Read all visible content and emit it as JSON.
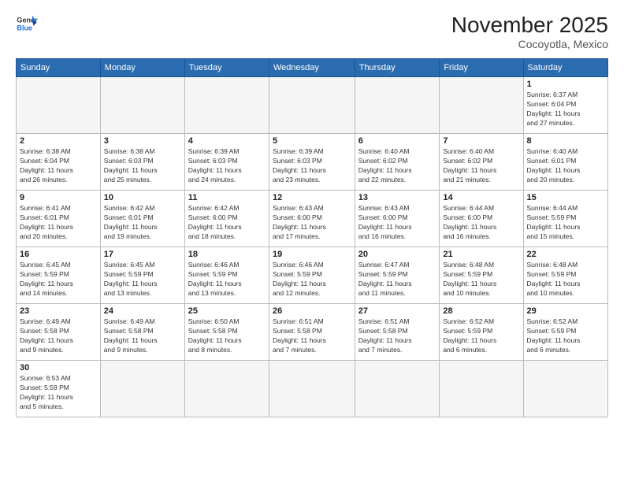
{
  "header": {
    "logo_line1": "General",
    "logo_line2": "Blue",
    "month_title": "November 2025",
    "location": "Cocoyotla, Mexico"
  },
  "weekdays": [
    "Sunday",
    "Monday",
    "Tuesday",
    "Wednesday",
    "Thursday",
    "Friday",
    "Saturday"
  ],
  "weeks": [
    [
      {
        "day": "",
        "info": ""
      },
      {
        "day": "",
        "info": ""
      },
      {
        "day": "",
        "info": ""
      },
      {
        "day": "",
        "info": ""
      },
      {
        "day": "",
        "info": ""
      },
      {
        "day": "",
        "info": ""
      },
      {
        "day": "1",
        "info": "Sunrise: 6:37 AM\nSunset: 6:04 PM\nDaylight: 11 hours\nand 27 minutes."
      }
    ],
    [
      {
        "day": "2",
        "info": "Sunrise: 6:38 AM\nSunset: 6:04 PM\nDaylight: 11 hours\nand 26 minutes."
      },
      {
        "day": "3",
        "info": "Sunrise: 6:38 AM\nSunset: 6:03 PM\nDaylight: 11 hours\nand 25 minutes."
      },
      {
        "day": "4",
        "info": "Sunrise: 6:39 AM\nSunset: 6:03 PM\nDaylight: 11 hours\nand 24 minutes."
      },
      {
        "day": "5",
        "info": "Sunrise: 6:39 AM\nSunset: 6:03 PM\nDaylight: 11 hours\nand 23 minutes."
      },
      {
        "day": "6",
        "info": "Sunrise: 6:40 AM\nSunset: 6:02 PM\nDaylight: 11 hours\nand 22 minutes."
      },
      {
        "day": "7",
        "info": "Sunrise: 6:40 AM\nSunset: 6:02 PM\nDaylight: 11 hours\nand 21 minutes."
      },
      {
        "day": "8",
        "info": "Sunrise: 6:40 AM\nSunset: 6:01 PM\nDaylight: 11 hours\nand 20 minutes."
      }
    ],
    [
      {
        "day": "9",
        "info": "Sunrise: 6:41 AM\nSunset: 6:01 PM\nDaylight: 11 hours\nand 20 minutes."
      },
      {
        "day": "10",
        "info": "Sunrise: 6:42 AM\nSunset: 6:01 PM\nDaylight: 11 hours\nand 19 minutes."
      },
      {
        "day": "11",
        "info": "Sunrise: 6:42 AM\nSunset: 6:00 PM\nDaylight: 11 hours\nand 18 minutes."
      },
      {
        "day": "12",
        "info": "Sunrise: 6:43 AM\nSunset: 6:00 PM\nDaylight: 11 hours\nand 17 minutes."
      },
      {
        "day": "13",
        "info": "Sunrise: 6:43 AM\nSunset: 6:00 PM\nDaylight: 11 hours\nand 16 minutes."
      },
      {
        "day": "14",
        "info": "Sunrise: 6:44 AM\nSunset: 6:00 PM\nDaylight: 11 hours\nand 16 minutes."
      },
      {
        "day": "15",
        "info": "Sunrise: 6:44 AM\nSunset: 5:59 PM\nDaylight: 11 hours\nand 15 minutes."
      }
    ],
    [
      {
        "day": "16",
        "info": "Sunrise: 6:45 AM\nSunset: 5:59 PM\nDaylight: 11 hours\nand 14 minutes."
      },
      {
        "day": "17",
        "info": "Sunrise: 6:45 AM\nSunset: 5:59 PM\nDaylight: 11 hours\nand 13 minutes."
      },
      {
        "day": "18",
        "info": "Sunrise: 6:46 AM\nSunset: 5:59 PM\nDaylight: 11 hours\nand 13 minutes."
      },
      {
        "day": "19",
        "info": "Sunrise: 6:46 AM\nSunset: 5:59 PM\nDaylight: 11 hours\nand 12 minutes."
      },
      {
        "day": "20",
        "info": "Sunrise: 6:47 AM\nSunset: 5:59 PM\nDaylight: 11 hours\nand 11 minutes."
      },
      {
        "day": "21",
        "info": "Sunrise: 6:48 AM\nSunset: 5:59 PM\nDaylight: 11 hours\nand 10 minutes."
      },
      {
        "day": "22",
        "info": "Sunrise: 6:48 AM\nSunset: 5:59 PM\nDaylight: 11 hours\nand 10 minutes."
      }
    ],
    [
      {
        "day": "23",
        "info": "Sunrise: 6:49 AM\nSunset: 5:58 PM\nDaylight: 11 hours\nand 9 minutes."
      },
      {
        "day": "24",
        "info": "Sunrise: 6:49 AM\nSunset: 5:58 PM\nDaylight: 11 hours\nand 9 minutes."
      },
      {
        "day": "25",
        "info": "Sunrise: 6:50 AM\nSunset: 5:58 PM\nDaylight: 11 hours\nand 8 minutes."
      },
      {
        "day": "26",
        "info": "Sunrise: 6:51 AM\nSunset: 5:58 PM\nDaylight: 11 hours\nand 7 minutes."
      },
      {
        "day": "27",
        "info": "Sunrise: 6:51 AM\nSunset: 5:58 PM\nDaylight: 11 hours\nand 7 minutes."
      },
      {
        "day": "28",
        "info": "Sunrise: 6:52 AM\nSunset: 5:59 PM\nDaylight: 11 hours\nand 6 minutes."
      },
      {
        "day": "29",
        "info": "Sunrise: 6:52 AM\nSunset: 5:59 PM\nDaylight: 11 hours\nand 6 minutes."
      }
    ],
    [
      {
        "day": "30",
        "info": "Sunrise: 6:53 AM\nSunset: 5:59 PM\nDaylight: 11 hours\nand 5 minutes."
      },
      {
        "day": "",
        "info": ""
      },
      {
        "day": "",
        "info": ""
      },
      {
        "day": "",
        "info": ""
      },
      {
        "day": "",
        "info": ""
      },
      {
        "day": "",
        "info": ""
      },
      {
        "day": "",
        "info": ""
      }
    ]
  ]
}
